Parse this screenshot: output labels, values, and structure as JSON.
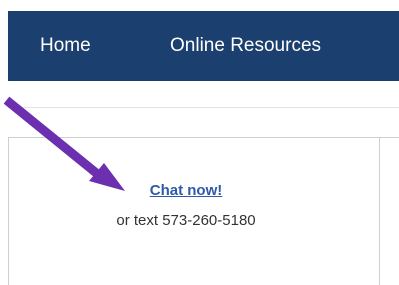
{
  "nav": {
    "items": [
      {
        "label": "Home"
      },
      {
        "label": "Online Resources"
      }
    ]
  },
  "chat": {
    "link_label": "Chat now!",
    "text_line": "or text 573-260-5180"
  },
  "colors": {
    "nav_bg": "#1b3f6e",
    "link": "#2f5aa8",
    "arrow": "#6b2fb0"
  }
}
